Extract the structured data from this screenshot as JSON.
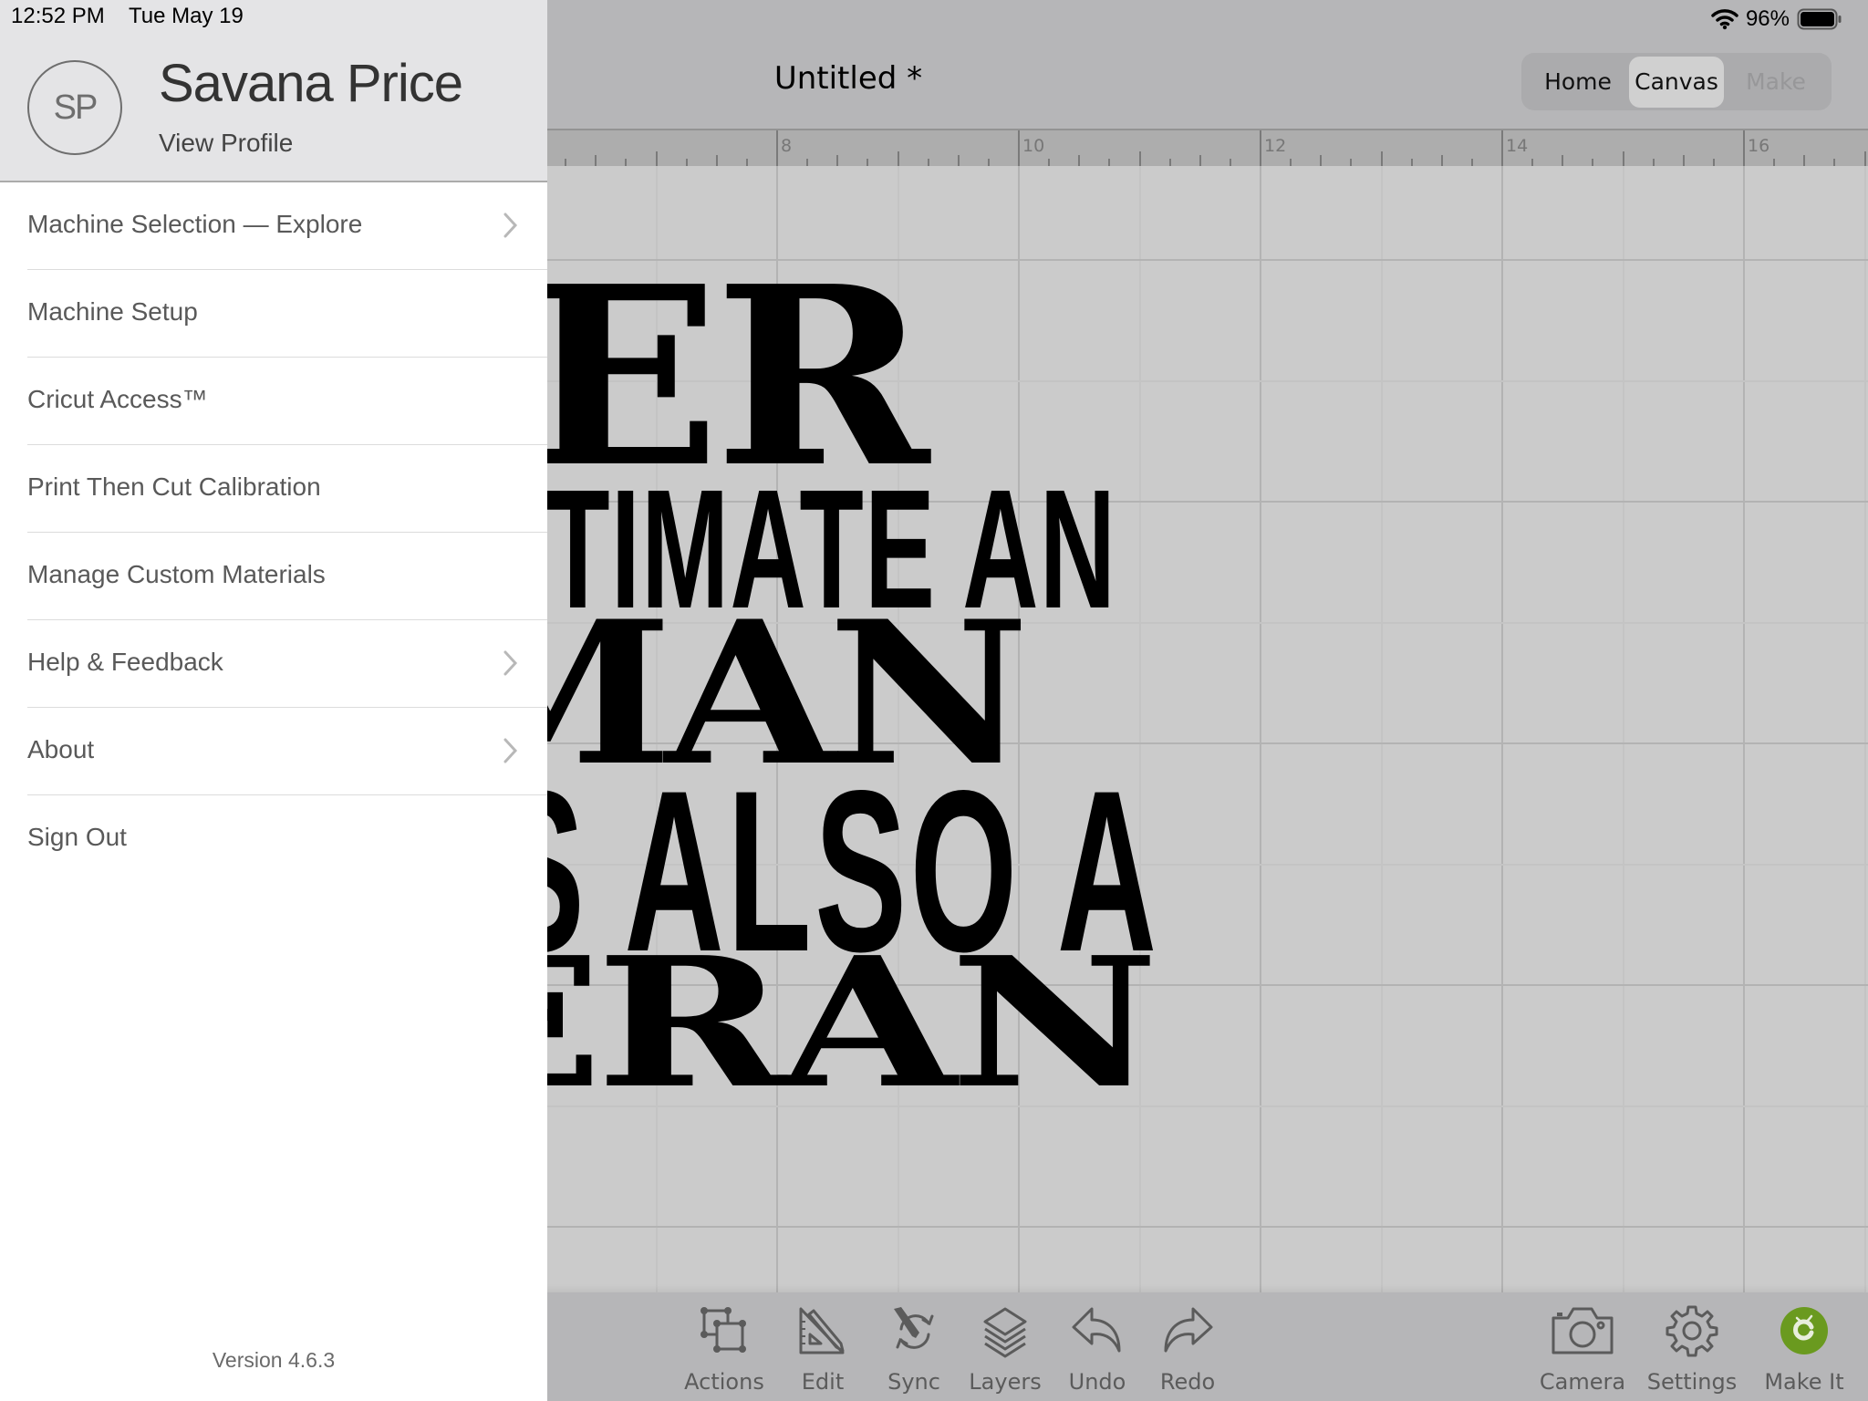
{
  "status_bar": {
    "time": "12:52 PM",
    "date": "Tue May 19",
    "battery": "96%"
  },
  "header": {
    "title": "Untitled *",
    "nav": [
      {
        "label": "Home",
        "state": "normal"
      },
      {
        "label": "Canvas",
        "state": "selected"
      },
      {
        "label": "Make",
        "state": "disabled"
      }
    ]
  },
  "ruler": {
    "unit": "in",
    "labels": [
      "8",
      "10",
      "12",
      "14",
      "16"
    ]
  },
  "design_text": {
    "lines": [
      "VER",
      "STIMATE AN",
      "MAN",
      "S ALSO A",
      "ERAN"
    ]
  },
  "sidebar": {
    "avatar_initials": "SP",
    "user_name": "Savana Price",
    "view_profile": "View Profile",
    "menu": [
      {
        "label": "Machine Selection — Explore",
        "chevron": true
      },
      {
        "label": "Machine Setup",
        "chevron": false
      },
      {
        "label": "Cricut Access™",
        "chevron": false
      },
      {
        "label": "Print Then Cut Calibration",
        "chevron": false
      },
      {
        "label": "Manage Custom Materials",
        "chevron": false
      },
      {
        "label": "Help & Feedback",
        "chevron": true
      },
      {
        "label": "About",
        "chevron": true
      },
      {
        "label": "Sign Out",
        "chevron": false
      }
    ],
    "version": "Version 4.6.3"
  },
  "toolbar": {
    "left": [
      {
        "label": "Actions",
        "icon": "actions-icon"
      },
      {
        "label": "Edit",
        "icon": "edit-icon"
      },
      {
        "label": "Sync",
        "icon": "sync-icon"
      },
      {
        "label": "Layers",
        "icon": "layers-icon"
      },
      {
        "label": "Undo",
        "icon": "undo-icon"
      },
      {
        "label": "Redo",
        "icon": "redo-icon"
      }
    ],
    "right": [
      {
        "label": "Camera",
        "icon": "camera-icon"
      },
      {
        "label": "Settings",
        "icon": "settings-icon"
      },
      {
        "label": "Make It",
        "icon": "make-it-icon"
      }
    ]
  },
  "colors": {
    "make_it_green": "#6a9a1f",
    "canvas_bg": "#cbcbcb",
    "header_bg": "#b6b6b8",
    "sidebar_header_bg": "#e4e4e6"
  }
}
